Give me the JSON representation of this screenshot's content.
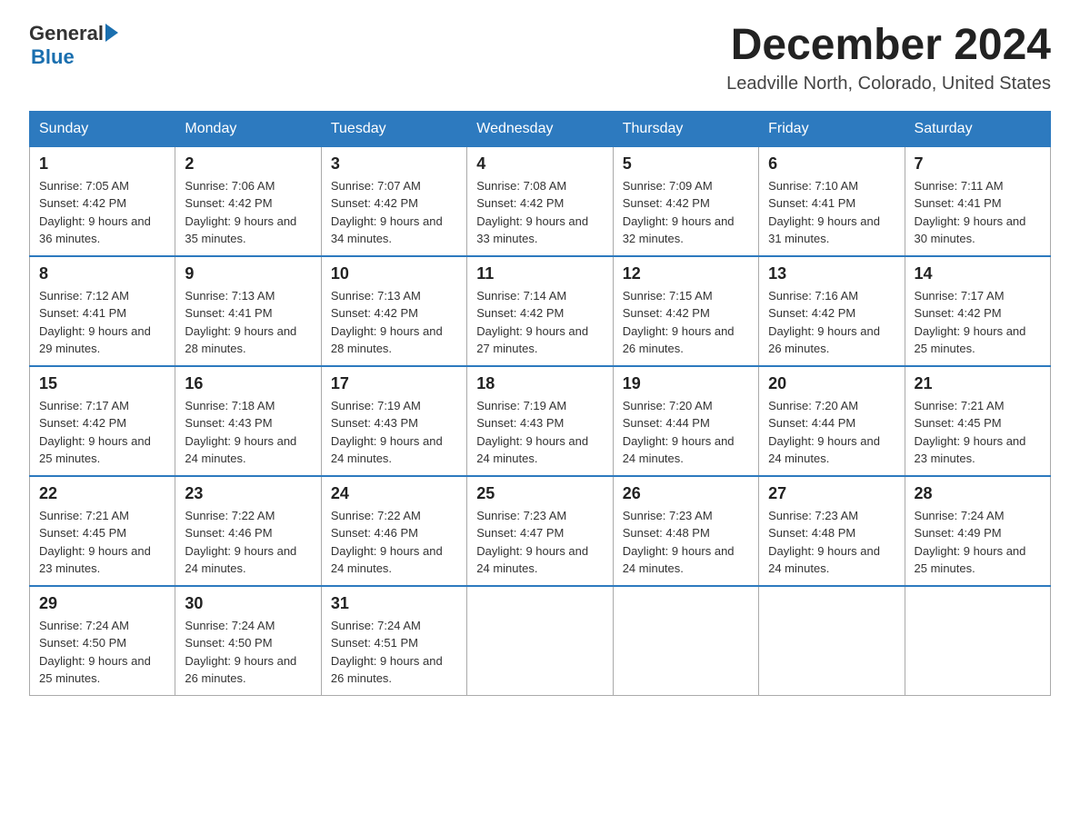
{
  "logo": {
    "general": "General",
    "blue": "Blue",
    "line2": "Blue"
  },
  "header": {
    "month_year": "December 2024",
    "location": "Leadville North, Colorado, United States"
  },
  "weekdays": [
    "Sunday",
    "Monday",
    "Tuesday",
    "Wednesday",
    "Thursday",
    "Friday",
    "Saturday"
  ],
  "weeks": [
    [
      {
        "day": "1",
        "sunrise": "Sunrise: 7:05 AM",
        "sunset": "Sunset: 4:42 PM",
        "daylight": "Daylight: 9 hours and 36 minutes."
      },
      {
        "day": "2",
        "sunrise": "Sunrise: 7:06 AM",
        "sunset": "Sunset: 4:42 PM",
        "daylight": "Daylight: 9 hours and 35 minutes."
      },
      {
        "day": "3",
        "sunrise": "Sunrise: 7:07 AM",
        "sunset": "Sunset: 4:42 PM",
        "daylight": "Daylight: 9 hours and 34 minutes."
      },
      {
        "day": "4",
        "sunrise": "Sunrise: 7:08 AM",
        "sunset": "Sunset: 4:42 PM",
        "daylight": "Daylight: 9 hours and 33 minutes."
      },
      {
        "day": "5",
        "sunrise": "Sunrise: 7:09 AM",
        "sunset": "Sunset: 4:42 PM",
        "daylight": "Daylight: 9 hours and 32 minutes."
      },
      {
        "day": "6",
        "sunrise": "Sunrise: 7:10 AM",
        "sunset": "Sunset: 4:41 PM",
        "daylight": "Daylight: 9 hours and 31 minutes."
      },
      {
        "day": "7",
        "sunrise": "Sunrise: 7:11 AM",
        "sunset": "Sunset: 4:41 PM",
        "daylight": "Daylight: 9 hours and 30 minutes."
      }
    ],
    [
      {
        "day": "8",
        "sunrise": "Sunrise: 7:12 AM",
        "sunset": "Sunset: 4:41 PM",
        "daylight": "Daylight: 9 hours and 29 minutes."
      },
      {
        "day": "9",
        "sunrise": "Sunrise: 7:13 AM",
        "sunset": "Sunset: 4:41 PM",
        "daylight": "Daylight: 9 hours and 28 minutes."
      },
      {
        "day": "10",
        "sunrise": "Sunrise: 7:13 AM",
        "sunset": "Sunset: 4:42 PM",
        "daylight": "Daylight: 9 hours and 28 minutes."
      },
      {
        "day": "11",
        "sunrise": "Sunrise: 7:14 AM",
        "sunset": "Sunset: 4:42 PM",
        "daylight": "Daylight: 9 hours and 27 minutes."
      },
      {
        "day": "12",
        "sunrise": "Sunrise: 7:15 AM",
        "sunset": "Sunset: 4:42 PM",
        "daylight": "Daylight: 9 hours and 26 minutes."
      },
      {
        "day": "13",
        "sunrise": "Sunrise: 7:16 AM",
        "sunset": "Sunset: 4:42 PM",
        "daylight": "Daylight: 9 hours and 26 minutes."
      },
      {
        "day": "14",
        "sunrise": "Sunrise: 7:17 AM",
        "sunset": "Sunset: 4:42 PM",
        "daylight": "Daylight: 9 hours and 25 minutes."
      }
    ],
    [
      {
        "day": "15",
        "sunrise": "Sunrise: 7:17 AM",
        "sunset": "Sunset: 4:42 PM",
        "daylight": "Daylight: 9 hours and 25 minutes."
      },
      {
        "day": "16",
        "sunrise": "Sunrise: 7:18 AM",
        "sunset": "Sunset: 4:43 PM",
        "daylight": "Daylight: 9 hours and 24 minutes."
      },
      {
        "day": "17",
        "sunrise": "Sunrise: 7:19 AM",
        "sunset": "Sunset: 4:43 PM",
        "daylight": "Daylight: 9 hours and 24 minutes."
      },
      {
        "day": "18",
        "sunrise": "Sunrise: 7:19 AM",
        "sunset": "Sunset: 4:43 PM",
        "daylight": "Daylight: 9 hours and 24 minutes."
      },
      {
        "day": "19",
        "sunrise": "Sunrise: 7:20 AM",
        "sunset": "Sunset: 4:44 PM",
        "daylight": "Daylight: 9 hours and 24 minutes."
      },
      {
        "day": "20",
        "sunrise": "Sunrise: 7:20 AM",
        "sunset": "Sunset: 4:44 PM",
        "daylight": "Daylight: 9 hours and 24 minutes."
      },
      {
        "day": "21",
        "sunrise": "Sunrise: 7:21 AM",
        "sunset": "Sunset: 4:45 PM",
        "daylight": "Daylight: 9 hours and 23 minutes."
      }
    ],
    [
      {
        "day": "22",
        "sunrise": "Sunrise: 7:21 AM",
        "sunset": "Sunset: 4:45 PM",
        "daylight": "Daylight: 9 hours and 23 minutes."
      },
      {
        "day": "23",
        "sunrise": "Sunrise: 7:22 AM",
        "sunset": "Sunset: 4:46 PM",
        "daylight": "Daylight: 9 hours and 24 minutes."
      },
      {
        "day": "24",
        "sunrise": "Sunrise: 7:22 AM",
        "sunset": "Sunset: 4:46 PM",
        "daylight": "Daylight: 9 hours and 24 minutes."
      },
      {
        "day": "25",
        "sunrise": "Sunrise: 7:23 AM",
        "sunset": "Sunset: 4:47 PM",
        "daylight": "Daylight: 9 hours and 24 minutes."
      },
      {
        "day": "26",
        "sunrise": "Sunrise: 7:23 AM",
        "sunset": "Sunset: 4:48 PM",
        "daylight": "Daylight: 9 hours and 24 minutes."
      },
      {
        "day": "27",
        "sunrise": "Sunrise: 7:23 AM",
        "sunset": "Sunset: 4:48 PM",
        "daylight": "Daylight: 9 hours and 24 minutes."
      },
      {
        "day": "28",
        "sunrise": "Sunrise: 7:24 AM",
        "sunset": "Sunset: 4:49 PM",
        "daylight": "Daylight: 9 hours and 25 minutes."
      }
    ],
    [
      {
        "day": "29",
        "sunrise": "Sunrise: 7:24 AM",
        "sunset": "Sunset: 4:50 PM",
        "daylight": "Daylight: 9 hours and 25 minutes."
      },
      {
        "day": "30",
        "sunrise": "Sunrise: 7:24 AM",
        "sunset": "Sunset: 4:50 PM",
        "daylight": "Daylight: 9 hours and 26 minutes."
      },
      {
        "day": "31",
        "sunrise": "Sunrise: 7:24 AM",
        "sunset": "Sunset: 4:51 PM",
        "daylight": "Daylight: 9 hours and 26 minutes."
      },
      null,
      null,
      null,
      null
    ]
  ]
}
